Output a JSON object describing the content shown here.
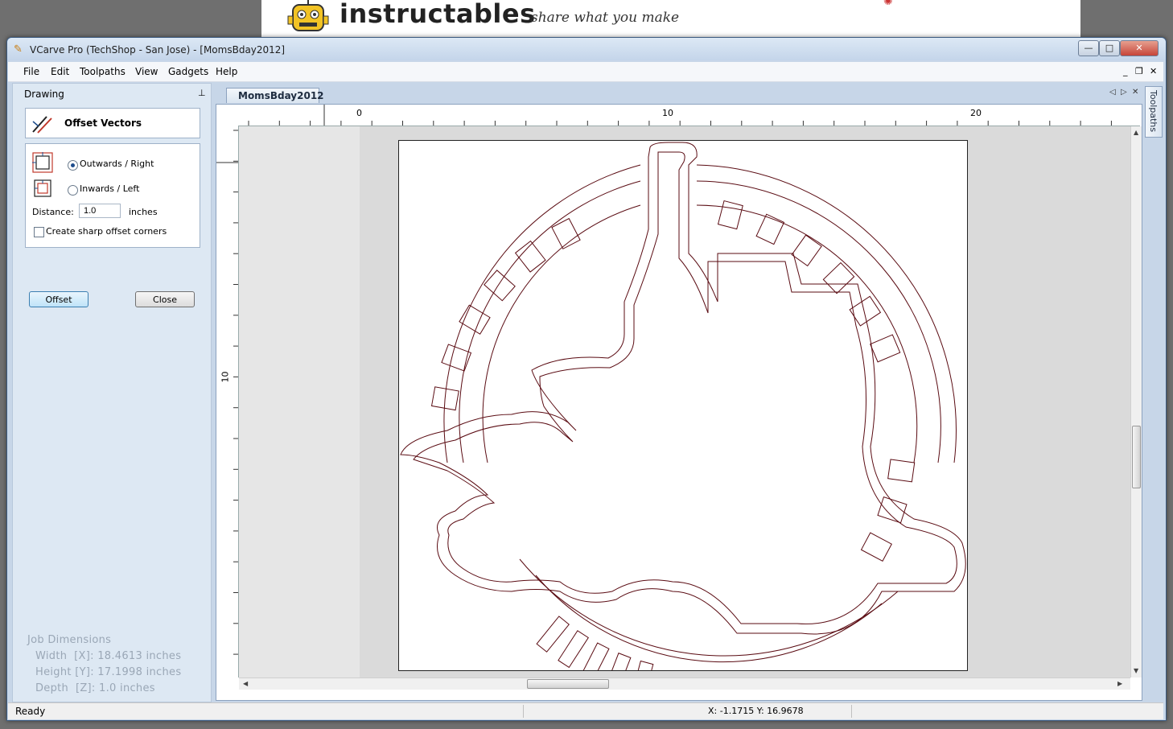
{
  "background": {
    "brand": "instructables",
    "tagline": "share what you make"
  },
  "window": {
    "title": "VCarve Pro (TechShop - San Jose) - [MomsBday2012]",
    "caption_buttons": {
      "minimize": "—",
      "maximize": "□",
      "close": "✕"
    }
  },
  "menu": {
    "items": [
      "File",
      "Edit",
      "Toolpaths",
      "View",
      "Gadgets",
      "Help"
    ],
    "mdi": {
      "minimize": "_",
      "restore": "❐",
      "close": "✕"
    }
  },
  "drawing_panel": {
    "header": "Drawing",
    "pin": "📌",
    "tool_title": "Offset Vectors",
    "outwards_label": "Outwards / Right",
    "inwards_label": "Inwards / Left",
    "direction_selected": "outwards",
    "distance_label": "Distance:",
    "distance_value": "1.0",
    "distance_unit": "inches",
    "sharp_corners_label": "Create sharp offset corners",
    "sharp_corners_checked": false,
    "offset_button": "Offset",
    "close_button": "Close",
    "job_dimensions": {
      "heading": "Job Dimensions",
      "width": "Width  [X]: 18.4613 inches",
      "height": "Height [Y]: 17.1998 inches",
      "depth": "Depth  [Z]: 1.0 inches"
    }
  },
  "document": {
    "tab_label": "MomsBday2012",
    "nav": {
      "prev": "◁",
      "next": "▷",
      "close": "✕"
    },
    "hruler_labels": [
      "0",
      "10",
      "20"
    ],
    "vruler_labels": [
      "10"
    ]
  },
  "right_tab": {
    "label": "Toolpaths"
  },
  "status": {
    "ready": "Ready",
    "coords": "X: -1.1715 Y: 16.9678"
  }
}
